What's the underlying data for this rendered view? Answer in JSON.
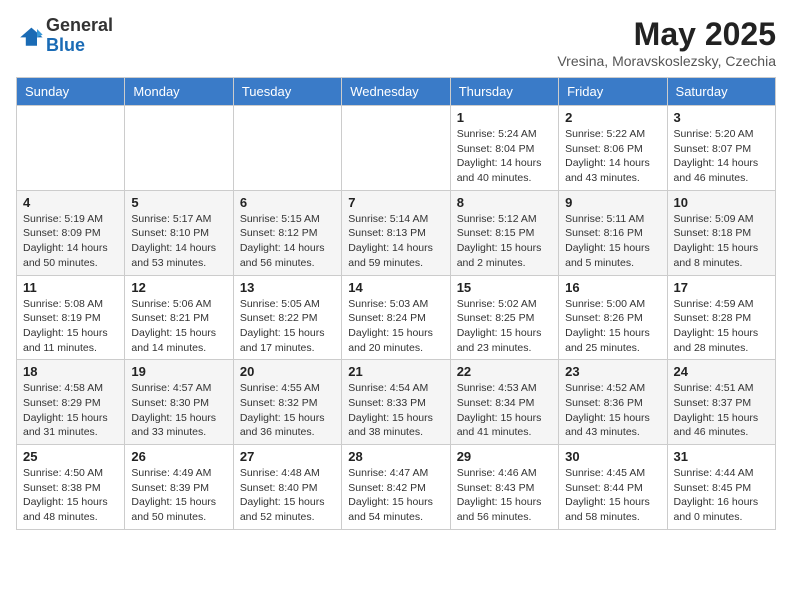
{
  "logo": {
    "general": "General",
    "blue": "Blue"
  },
  "header": {
    "title": "May 2025",
    "location": "Vresina, Moravskoslezsky, Czechia"
  },
  "weekdays": [
    "Sunday",
    "Monday",
    "Tuesday",
    "Wednesday",
    "Thursday",
    "Friday",
    "Saturday"
  ],
  "weeks": [
    [
      {
        "day": "",
        "info": ""
      },
      {
        "day": "",
        "info": ""
      },
      {
        "day": "",
        "info": ""
      },
      {
        "day": "",
        "info": ""
      },
      {
        "day": "1",
        "info": "Sunrise: 5:24 AM\nSunset: 8:04 PM\nDaylight: 14 hours\nand 40 minutes."
      },
      {
        "day": "2",
        "info": "Sunrise: 5:22 AM\nSunset: 8:06 PM\nDaylight: 14 hours\nand 43 minutes."
      },
      {
        "day": "3",
        "info": "Sunrise: 5:20 AM\nSunset: 8:07 PM\nDaylight: 14 hours\nand 46 minutes."
      }
    ],
    [
      {
        "day": "4",
        "info": "Sunrise: 5:19 AM\nSunset: 8:09 PM\nDaylight: 14 hours\nand 50 minutes."
      },
      {
        "day": "5",
        "info": "Sunrise: 5:17 AM\nSunset: 8:10 PM\nDaylight: 14 hours\nand 53 minutes."
      },
      {
        "day": "6",
        "info": "Sunrise: 5:15 AM\nSunset: 8:12 PM\nDaylight: 14 hours\nand 56 minutes."
      },
      {
        "day": "7",
        "info": "Sunrise: 5:14 AM\nSunset: 8:13 PM\nDaylight: 14 hours\nand 59 minutes."
      },
      {
        "day": "8",
        "info": "Sunrise: 5:12 AM\nSunset: 8:15 PM\nDaylight: 15 hours\nand 2 minutes."
      },
      {
        "day": "9",
        "info": "Sunrise: 5:11 AM\nSunset: 8:16 PM\nDaylight: 15 hours\nand 5 minutes."
      },
      {
        "day": "10",
        "info": "Sunrise: 5:09 AM\nSunset: 8:18 PM\nDaylight: 15 hours\nand 8 minutes."
      }
    ],
    [
      {
        "day": "11",
        "info": "Sunrise: 5:08 AM\nSunset: 8:19 PM\nDaylight: 15 hours\nand 11 minutes."
      },
      {
        "day": "12",
        "info": "Sunrise: 5:06 AM\nSunset: 8:21 PM\nDaylight: 15 hours\nand 14 minutes."
      },
      {
        "day": "13",
        "info": "Sunrise: 5:05 AM\nSunset: 8:22 PM\nDaylight: 15 hours\nand 17 minutes."
      },
      {
        "day": "14",
        "info": "Sunrise: 5:03 AM\nSunset: 8:24 PM\nDaylight: 15 hours\nand 20 minutes."
      },
      {
        "day": "15",
        "info": "Sunrise: 5:02 AM\nSunset: 8:25 PM\nDaylight: 15 hours\nand 23 minutes."
      },
      {
        "day": "16",
        "info": "Sunrise: 5:00 AM\nSunset: 8:26 PM\nDaylight: 15 hours\nand 25 minutes."
      },
      {
        "day": "17",
        "info": "Sunrise: 4:59 AM\nSunset: 8:28 PM\nDaylight: 15 hours\nand 28 minutes."
      }
    ],
    [
      {
        "day": "18",
        "info": "Sunrise: 4:58 AM\nSunset: 8:29 PM\nDaylight: 15 hours\nand 31 minutes."
      },
      {
        "day": "19",
        "info": "Sunrise: 4:57 AM\nSunset: 8:30 PM\nDaylight: 15 hours\nand 33 minutes."
      },
      {
        "day": "20",
        "info": "Sunrise: 4:55 AM\nSunset: 8:32 PM\nDaylight: 15 hours\nand 36 minutes."
      },
      {
        "day": "21",
        "info": "Sunrise: 4:54 AM\nSunset: 8:33 PM\nDaylight: 15 hours\nand 38 minutes."
      },
      {
        "day": "22",
        "info": "Sunrise: 4:53 AM\nSunset: 8:34 PM\nDaylight: 15 hours\nand 41 minutes."
      },
      {
        "day": "23",
        "info": "Sunrise: 4:52 AM\nSunset: 8:36 PM\nDaylight: 15 hours\nand 43 minutes."
      },
      {
        "day": "24",
        "info": "Sunrise: 4:51 AM\nSunset: 8:37 PM\nDaylight: 15 hours\nand 46 minutes."
      }
    ],
    [
      {
        "day": "25",
        "info": "Sunrise: 4:50 AM\nSunset: 8:38 PM\nDaylight: 15 hours\nand 48 minutes."
      },
      {
        "day": "26",
        "info": "Sunrise: 4:49 AM\nSunset: 8:39 PM\nDaylight: 15 hours\nand 50 minutes."
      },
      {
        "day": "27",
        "info": "Sunrise: 4:48 AM\nSunset: 8:40 PM\nDaylight: 15 hours\nand 52 minutes."
      },
      {
        "day": "28",
        "info": "Sunrise: 4:47 AM\nSunset: 8:42 PM\nDaylight: 15 hours\nand 54 minutes."
      },
      {
        "day": "29",
        "info": "Sunrise: 4:46 AM\nSunset: 8:43 PM\nDaylight: 15 hours\nand 56 minutes."
      },
      {
        "day": "30",
        "info": "Sunrise: 4:45 AM\nSunset: 8:44 PM\nDaylight: 15 hours\nand 58 minutes."
      },
      {
        "day": "31",
        "info": "Sunrise: 4:44 AM\nSunset: 8:45 PM\nDaylight: 16 hours\nand 0 minutes."
      }
    ]
  ]
}
